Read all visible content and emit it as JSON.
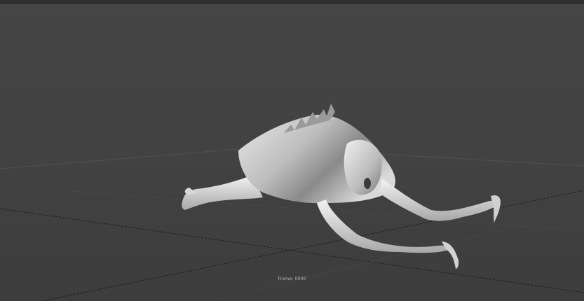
{
  "viewport": {
    "frame_label": "Frame: 0000",
    "colors": {
      "background": "#424242",
      "grid_line": "#2a2a2a",
      "grid_dash": "#1e1e1e",
      "model_highlight": "#f2f2f2",
      "model_shadow": "#6a6a6a"
    },
    "icons": {
      "model": "creature-model-icon",
      "grid": "ground-grid-icon"
    }
  }
}
